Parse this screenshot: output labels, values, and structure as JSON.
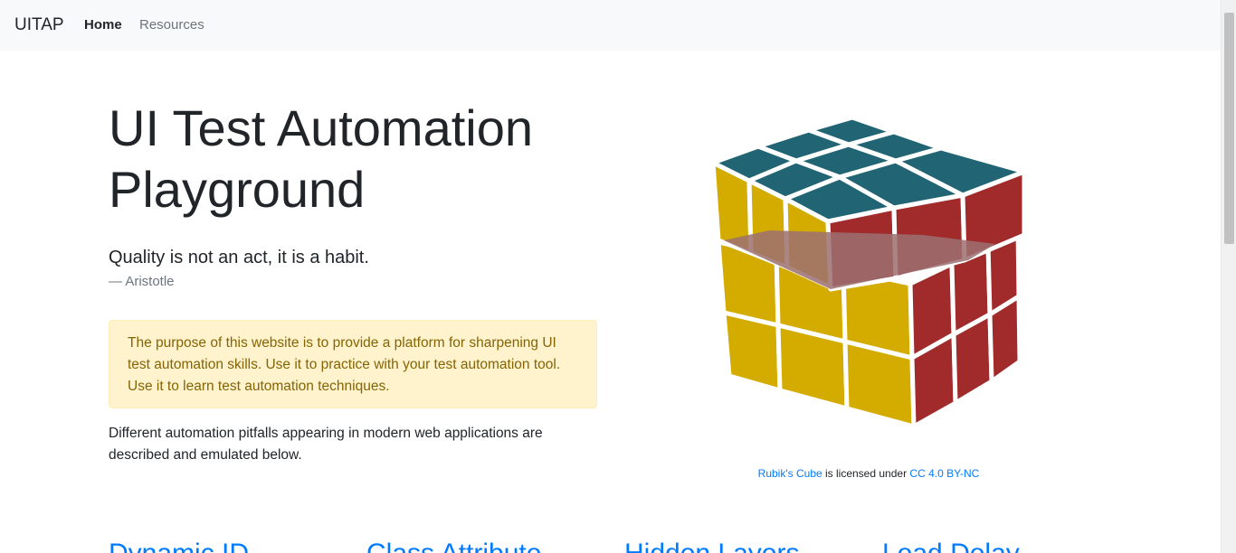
{
  "nav": {
    "brand": "UITAP",
    "items": [
      {
        "label": "Home",
        "active": true
      },
      {
        "label": "Resources",
        "active": false
      }
    ]
  },
  "hero": {
    "title": "UI Test Automation Playground",
    "quote": "Quality is not an act, it is a habit.",
    "author": "— Aristotle"
  },
  "alert": {
    "text": "The purpose of this website is to provide a platform for sharpening UI test automation skills. Use it to practice with your test automation tool. Use it to learn test automation techniques."
  },
  "intro": {
    "text": "Different automation pitfalls appearing in modern web applications are described and emulated below."
  },
  "credit": {
    "link1": "Rubik's Cube",
    "middle": " is licensed under ",
    "link2": "CC 4.0 BY-NC"
  },
  "sections": [
    {
      "label": "Dynamic ID"
    },
    {
      "label": "Class Attribute"
    },
    {
      "label": "Hidden Layers"
    },
    {
      "label": "Load Delay"
    }
  ],
  "colors": {
    "link": "#007bff",
    "navbar_bg": "#f8f9fa",
    "alert_bg": "#fff3cd",
    "alert_text": "#856404",
    "cube_top": "#216473",
    "cube_front": "#d4ac00",
    "cube_side": "#a12b2b"
  }
}
